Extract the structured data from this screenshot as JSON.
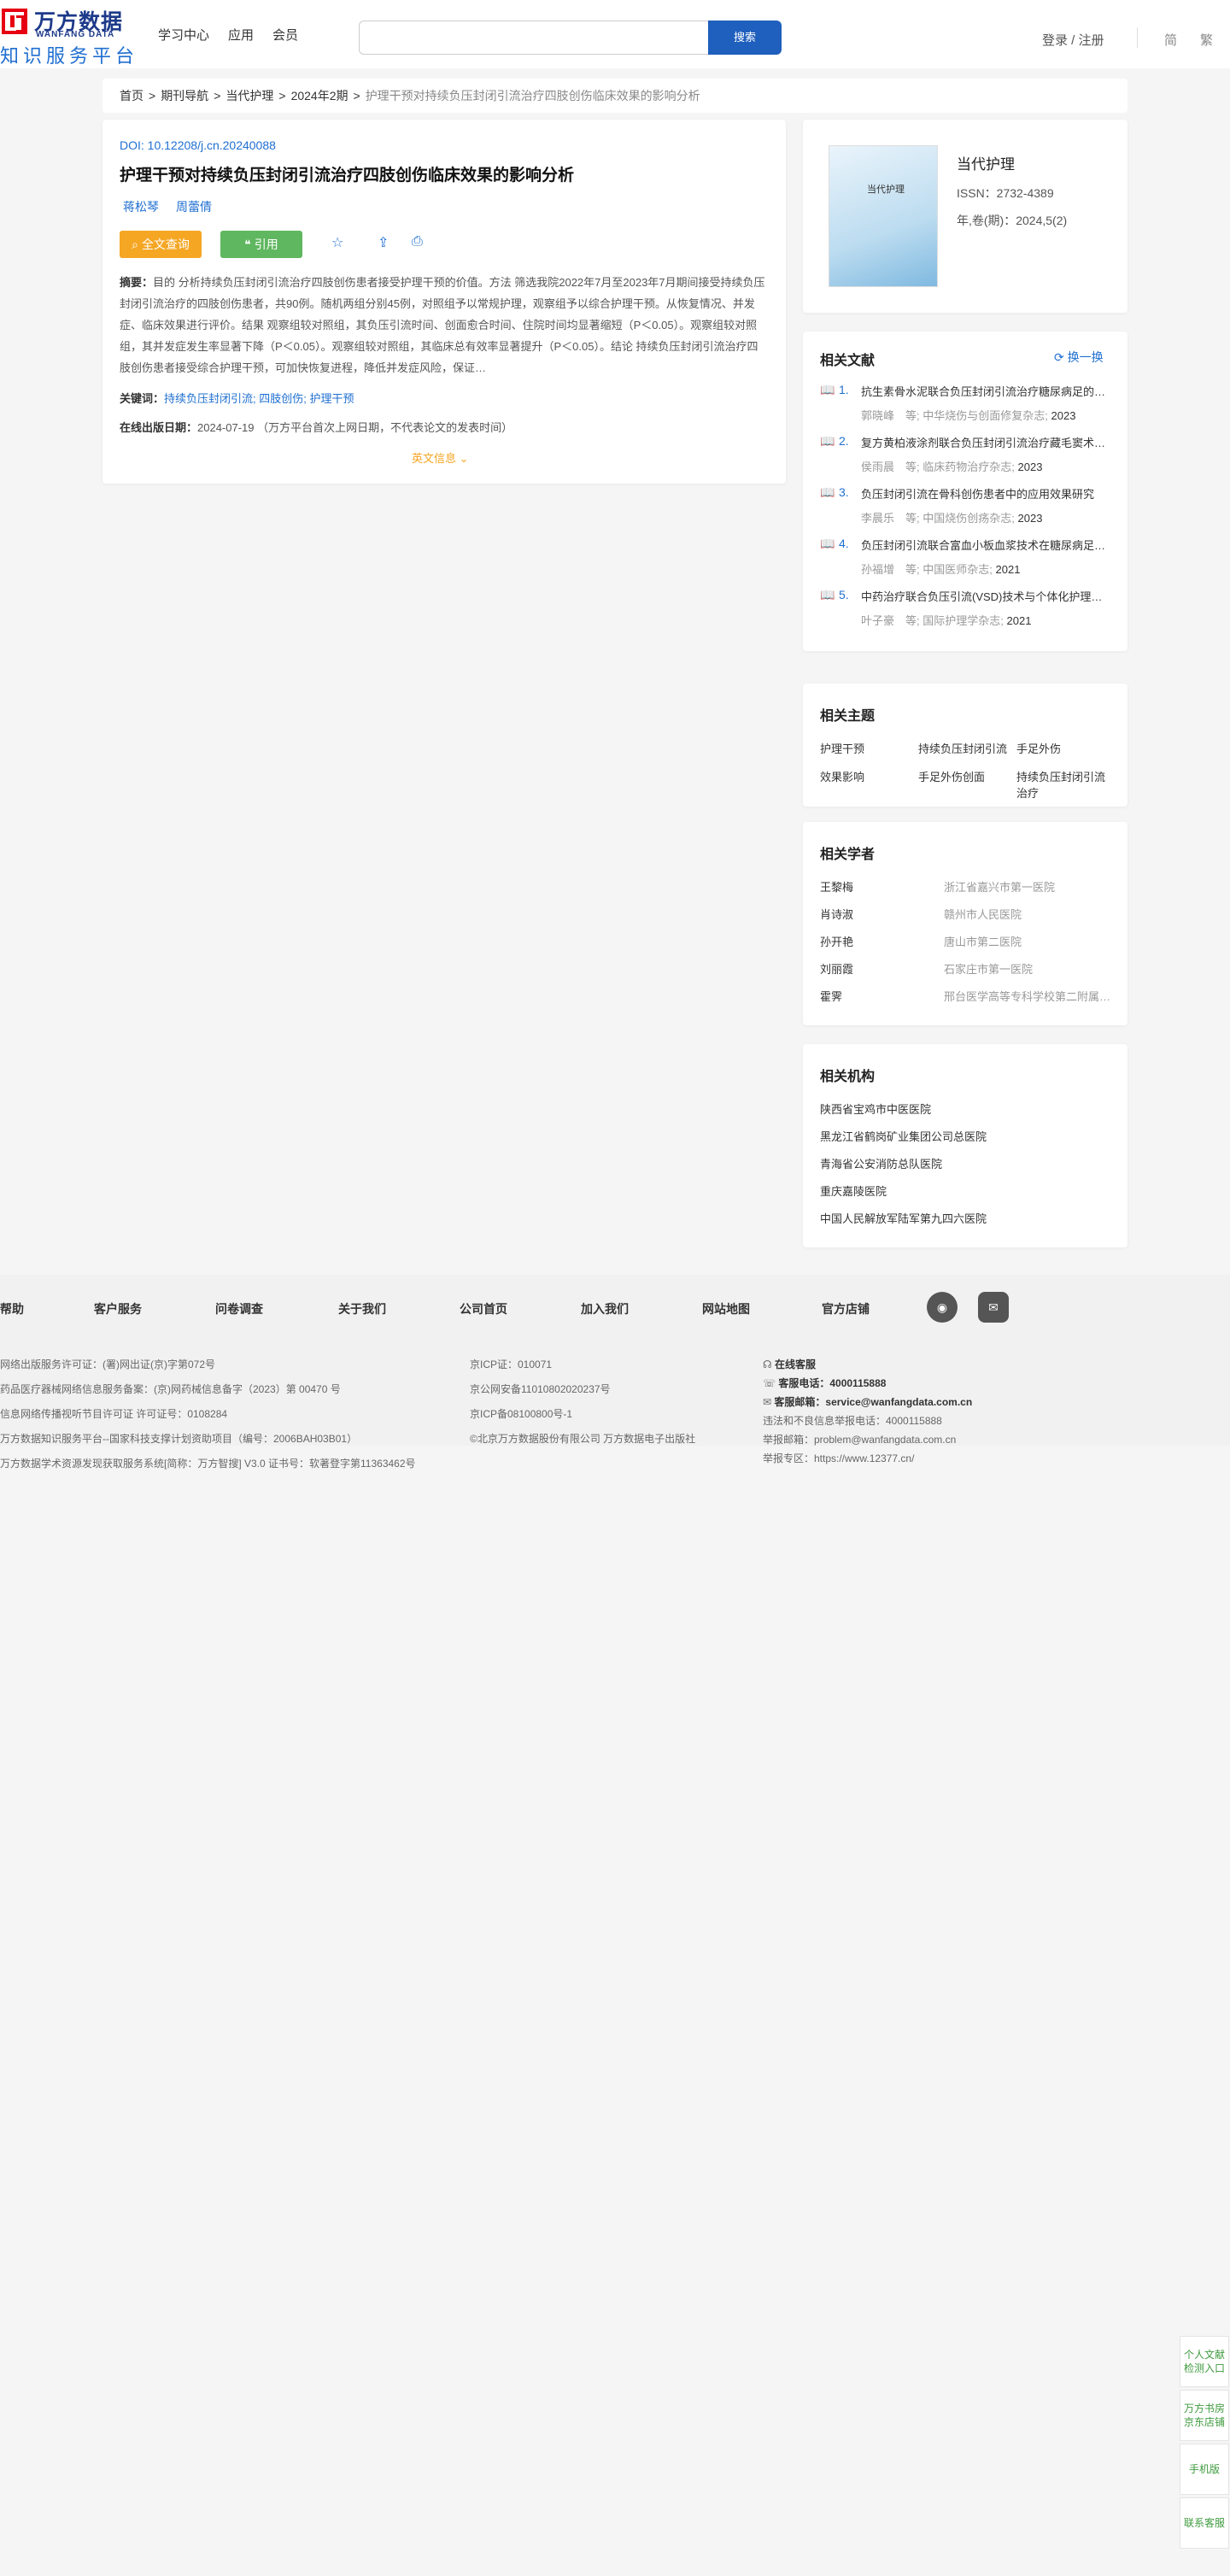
{
  "header": {
    "logo_cn": "万方数据",
    "logo_en": "WANFANG DATA",
    "logo_sub": "知识服务平台",
    "nav": [
      "学习中心",
      "应用",
      "会员"
    ],
    "search_button": "搜索",
    "login": "登录 / 注册",
    "lang_simplified": "简",
    "lang_traditional": "繁"
  },
  "breadcrumb": {
    "items": [
      "首页",
      "期刊导航",
      "当代护理",
      "2024年2期"
    ],
    "current": "护理干预对持续负压封闭引流治疗四肢创伤临床效果的影响分析",
    "separator": ">"
  },
  "article": {
    "doi_label": "DOI:",
    "doi": "10.12208/j.cn.20240088",
    "title": "护理干预对持续负压封闭引流治疗四肢创伤临床效果的影响分析",
    "authors": [
      "蒋松琴",
      "周蕾倩"
    ],
    "full_text_button": "全文查询",
    "cite_button": "引用",
    "abstract_label": "摘要：",
    "abstract": "目的 分析持续负压封闭引流治疗四肢创伤患者接受护理干预的价值。方法 筛选我院2022年7月至2023年7月期间接受持续负压封闭引流治疗的四肢创伤患者，共90例。随机两组分别45例，对照组予以常规护理，观察组予以综合护理干预。从恢复情况、并发症、临床效果进行评价。结果 观察组较对照组，其负压引流时间、创面愈合时间、住院时间均显著缩短（P＜0.05）。观察组较对照组，其并发症发生率显著下降（P＜0.05）。观察组较对照组，其临床总有效率显著提升（P＜0.05）。结论 持续负压封闭引流治疗四肢创伤患者接受综合护理干预，可加快恢复进程，降低并发症风险，保证…",
    "keywords_label": "关键词：",
    "keywords": "持续负压封闭引流; 四肢创伤; 护理干预",
    "pub_date_label": "在线出版日期：",
    "pub_date": "2024-07-19",
    "pub_date_note": "（万方平台首次上网日期，不代表论文的发表时间）",
    "english_info": "英文信息"
  },
  "journal": {
    "cover_title": "当代护理",
    "name": "当代护理",
    "issn": "ISSN：2732-4389",
    "year_issue": "年,卷(期)：2024,5(2)"
  },
  "related": {
    "title": "相关文献",
    "refresh": "换一换",
    "items": [
      {
        "n": "1.",
        "title": "抗生素骨水泥联合负压封闭引流治疗糖尿病足的临床效果分析",
        "authors": "郭晓峰　等;",
        "journal": "中华烧伤与创面修复杂志",
        "year": "2023"
      },
      {
        "n": "2.",
        "title": "复方黄柏液涂剂联合负压封闭引流治疗藏毛窦术后创面的临床观察",
        "authors": "侯雨晨　等;",
        "journal": "临床药物治疗杂志",
        "year": "2023"
      },
      {
        "n": "3.",
        "title": "负压封闭引流在骨科创伤患者中的应用效果研究",
        "authors": "李晨乐　等;",
        "journal": "中国烧伤创疡杂志",
        "year": "2023"
      },
      {
        "n": "4.",
        "title": "负压封闭引流联合富血小板血浆技术在糖尿病足中的应用",
        "authors": "孙福增　等;",
        "journal": "中国医师杂志",
        "year": "2021"
      },
      {
        "n": "5.",
        "title": "中药治疗联合负压引流(VSD)技术与个体化护理的应用",
        "authors": "叶子豪　等;",
        "journal": "国际护理学杂志",
        "year": "2021"
      }
    ]
  },
  "topics": {
    "title": "相关主题",
    "items": [
      "护理干预",
      "持续负压封闭引流",
      "手足外伤",
      "效果影响",
      "手足外伤创面",
      "持续负压封闭引流治疗"
    ]
  },
  "scholars": {
    "title": "相关学者",
    "items": [
      {
        "name": "王黎梅",
        "org": "浙江省嘉兴市第一医院"
      },
      {
        "name": "肖诗淑",
        "org": "赣州市人民医院"
      },
      {
        "name": "孙开艳",
        "org": "唐山市第二医院"
      },
      {
        "name": "刘丽霞",
        "org": "石家庄市第一医院"
      },
      {
        "name": "霍霁",
        "org": "邢台医学高等专科学校第二附属医院"
      }
    ]
  },
  "orgs": {
    "title": "相关机构",
    "items": [
      "陕西省宝鸡市中医医院",
      "黑龙江省鹤岗矿业集团公司总医院",
      "青海省公安消防总队医院",
      "重庆嘉陵医院",
      "中国人民解放军陆军第九四六医院"
    ]
  },
  "footer": {
    "nav": [
      "帮助",
      "客户服务",
      "问卷调查",
      "关于我们",
      "公司首页",
      "加入我们",
      "网站地图",
      "官方店铺"
    ],
    "col1": [
      "网络出版服务许可证：(署)网出证(京)字第072号",
      "药品医疗器械网络信息服务备案：(京)网药械信息备字（2023）第 00470 号",
      "信息网络传播视听节目许可证 许可证号：0108284",
      "万方数据知识服务平台--国家科技支撑计划资助项目（编号：2006BAH03B01）",
      "万方数据学术资源发现获取服务系统[简称：万方智搜] V3.0 证书号：软著登字第11363462号"
    ],
    "col2": [
      "京ICP证：010071",
      "京公网安备11010802020237号",
      "京ICP备08100800号-1",
      "©北京万方数据股份有限公司 万方数据电子出版社"
    ],
    "online_service": "在线客服",
    "phone_label": "客服电话：",
    "phone": "4000115888",
    "email_label": "客服邮箱：",
    "email": "service@wanfangdata.com.cn",
    "report_phone": "违法和不良信息举报电话：4000115888",
    "report_email": "举报邮箱：problem@wanfangdata.com.cn",
    "report_site": "举报专区：https://www.12377.cn/"
  },
  "float": {
    "items": [
      "个人文献检测入口",
      "万方书房京东店铺",
      "手机版",
      "联系客服"
    ]
  }
}
